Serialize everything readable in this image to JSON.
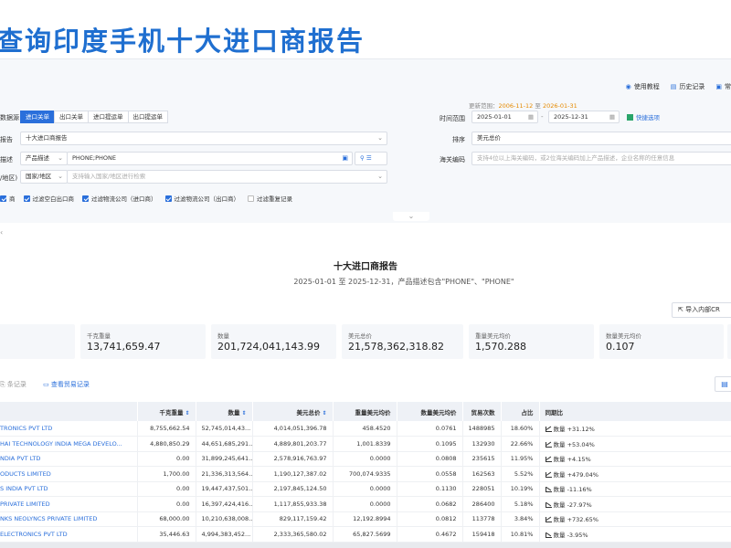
{
  "page_title": "查询印度手机十大进口商报告",
  "top_links": [
    {
      "icon": "help-icon",
      "label": "使用教程"
    },
    {
      "icon": "history-icon",
      "label": "历史记录"
    },
    {
      "icon": "more-icon",
      "label": "常"
    }
  ],
  "update_range": {
    "label": "更新范围：",
    "start": "2006-11-12",
    "sep": "至",
    "end": "2026-01-31"
  },
  "form": {
    "data_source_label": "数据源",
    "data_source_tabs": [
      "进口关单",
      "出口关单",
      "进口提运单",
      "出口提运单"
    ],
    "report_label": "报告",
    "report_value": "十大进口商报告",
    "product_label": "描述",
    "product_type": "产品描述",
    "product_value": "PHONE;PHONE",
    "region_label": "/地区)",
    "region_type": "国家/地区",
    "region_placeholder": "支持输入国家/地区进行检索",
    "time_label": "时间范围",
    "date_start": "2025-01-01",
    "date_sep": "-",
    "date_end": "2025-12-31",
    "quick_select": "快捷选项",
    "sort_label": "排序",
    "sort_value": "美元总价",
    "hs_label": "海关编码",
    "hs_placeholder": "支持4位以上海关编码，或2位海关编码加上产品描述，企业名称的任意信息",
    "checkboxes": [
      {
        "label": "商",
        "checked": true
      },
      {
        "label": "过滤空白出口商",
        "checked": true
      },
      {
        "label": "过滤物流公司（进口商）",
        "checked": true
      },
      {
        "label": "过滤物流公司（出口商）",
        "checked": true
      },
      {
        "label": "过滤重复记录",
        "checked": false
      }
    ]
  },
  "report": {
    "title": "十大进口商报告",
    "subtitle": "2025-01-01 至 2025-12-31，产品描述包含\"PHONE\"、\"PHONE\"",
    "export_label": "导入内部CR",
    "stats": [
      {
        "label": "千克重量",
        "value": "13,741,659.47"
      },
      {
        "label": "数量",
        "value": "201,724,041,143.99"
      },
      {
        "label": "美元总价",
        "value": "21,578,362,318.82"
      },
      {
        "label": "重量美元均价",
        "value": "1,570.288"
      },
      {
        "label": "数量美元均价",
        "value": "0.107"
      }
    ],
    "link_records": "条记录",
    "link_trade": "查看贸易记录"
  },
  "table": {
    "columns": [
      "",
      "千克重量",
      "数量",
      "美元总价",
      "重量美元均价",
      "数量美元均价",
      "贸易次数",
      "占比",
      "同期比"
    ],
    "rows": [
      {
        "company": "TRONICS PVT LTD",
        "kg": "8,755,662.54",
        "qty": "52,745,014,43...",
        "usd": "4,014,051,396.78",
        "kg_avg": "458.4520",
        "qty_avg": "0.0761",
        "trades": "1488985",
        "share": "18.60%",
        "yoy_label": "数量",
        "yoy": "+31.12%",
        "dir": "up"
      },
      {
        "company": "HAI TECHNOLOGY INDIA MEGA DEVELO...",
        "kg": "4,880,850.29",
        "qty": "44,651,685,291...",
        "usd": "4,889,801,203.77",
        "kg_avg": "1,001.8339",
        "qty_avg": "0.1095",
        "trades": "132930",
        "share": "22.66%",
        "yoy_label": "数量",
        "yoy": "+53.04%",
        "dir": "up"
      },
      {
        "company": "NDIA PVT LTD",
        "kg": "0.00",
        "qty": "31,899,245,641...",
        "usd": "2,578,916,763.97",
        "kg_avg": "0.0000",
        "qty_avg": "0.0808",
        "trades": "235615",
        "share": "11.95%",
        "yoy_label": "数量",
        "yoy": "+4.15%",
        "dir": "up"
      },
      {
        "company": "ODUCTS LIMITED",
        "kg": "1,700.00",
        "qty": "21,336,313,564...",
        "usd": "1,190,127,387.02",
        "kg_avg": "700,074.9335",
        "qty_avg": "0.0558",
        "trades": "162563",
        "share": "5.52%",
        "yoy_label": "数量",
        "yoy": "+479.04%",
        "dir": "up"
      },
      {
        "company": "S INDIA PVT LTD",
        "kg": "0.00",
        "qty": "19,447,437,501...",
        "usd": "2,197,845,124.50",
        "kg_avg": "0.0000",
        "qty_avg": "0.1130",
        "trades": "228051",
        "share": "10.19%",
        "yoy_label": "数量",
        "yoy": "-11.16%",
        "dir": "down"
      },
      {
        "company": "PRIVATE LIMITED",
        "kg": "0.00",
        "qty": "16,397,424,416...",
        "usd": "1,117,855,933.38",
        "kg_avg": "0.0000",
        "qty_avg": "0.0682",
        "trades": "286400",
        "share": "5.18%",
        "yoy_label": "数量",
        "yoy": "-27.97%",
        "dir": "down"
      },
      {
        "company": "NKS NEOLYNCS PRIVATE LIMITED",
        "kg": "68,000.00",
        "qty": "10,210,638,008...",
        "usd": "829,117,159.42",
        "kg_avg": "12,192.8994",
        "qty_avg": "0.0812",
        "trades": "113778",
        "share": "3.84%",
        "yoy_label": "数量",
        "yoy": "+732.65%",
        "dir": "up"
      },
      {
        "company": "ELECTRONICS PVT LTD",
        "kg": "35,446.63",
        "qty": "4,994,383,452...",
        "usd": "2,333,365,580.02",
        "kg_avg": "65,827.5699",
        "qty_avg": "0.4672",
        "trades": "159418",
        "share": "10.81%",
        "yoy_label": "数量",
        "yoy": "-3.95%",
        "dir": "down"
      }
    ]
  },
  "colors": {
    "accent": "#2a6fdb",
    "title": "#1f6fd0",
    "up": "#e23b3b",
    "down": "#2aa56a",
    "update_date": "#e58a00"
  }
}
